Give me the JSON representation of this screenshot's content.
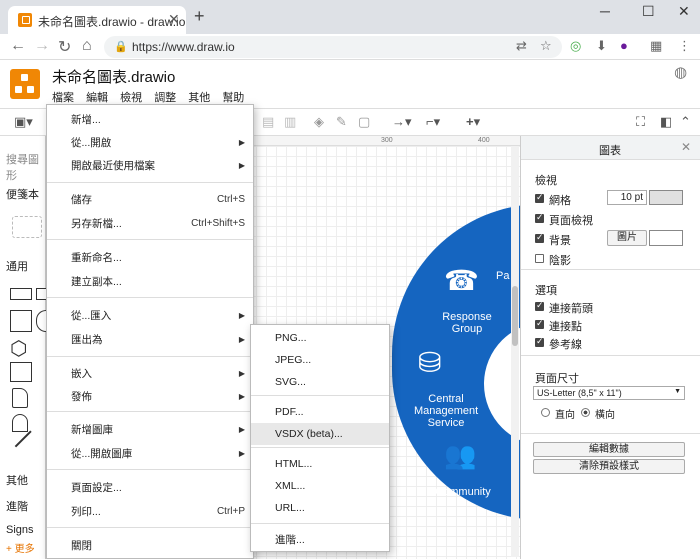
{
  "browser": {
    "tab_title": "未命名圖表.drawio - draw.io",
    "tab_close": "✕",
    "new_tab": "+",
    "win_min": "─",
    "win_max": "☐",
    "win_close": "✕",
    "url": "https://www.draw.io"
  },
  "app": {
    "doc_title": "未命名圖表.drawio",
    "menus": [
      "檔案",
      "編輯",
      "檢視",
      "調整",
      "其他",
      "幫助"
    ]
  },
  "left_panel": {
    "search_placeholder": "搜尋圖形",
    "scratchpad": "便箋本",
    "general": "通用",
    "other": "其他",
    "advanced": "進階",
    "signs": "Signs",
    "more": "+ 更多"
  },
  "canvas": {
    "ruler_marks": [
      "300",
      "400"
    ],
    "labels": {
      "response_group": "Response Group",
      "central_mgmt": "Central Management Service",
      "community": "Community",
      "pa": "Pa"
    }
  },
  "right_panel": {
    "title": "圖表",
    "view_title": "檢視",
    "grid": "網格",
    "grid_size": "10 pt",
    "page_view": "頁面檢視",
    "background": "背景",
    "image_btn": "圖片",
    "shadow": "陰影",
    "options_title": "選項",
    "conn_arrows": "連接箭頭",
    "conn_points": "連接點",
    "guides": "參考線",
    "page_size_title": "頁面尺寸",
    "page_size_value": "US-Letter (8,5\" x 11\")",
    "portrait": "直向",
    "landscape": "橫向",
    "edit_data_btn": "編輯數據",
    "clear_style_btn": "清除預設樣式"
  },
  "file_menu": [
    {
      "label": "新增...",
      "shortcut": "",
      "arrow": false
    },
    {
      "label": "從...開啟",
      "shortcut": "",
      "arrow": true
    },
    {
      "label": "開啟最近使用檔案",
      "shortcut": "",
      "arrow": true
    },
    {
      "label": "儲存",
      "shortcut": "Ctrl+S",
      "arrow": false
    },
    {
      "label": "另存新檔...",
      "shortcut": "Ctrl+Shift+S",
      "arrow": false
    },
    {
      "label": "重新命名...",
      "shortcut": "",
      "arrow": false
    },
    {
      "label": "建立副本...",
      "shortcut": "",
      "arrow": false
    },
    {
      "label": "從...匯入",
      "shortcut": "",
      "arrow": true
    },
    {
      "label": "匯出為",
      "shortcut": "",
      "arrow": true
    },
    {
      "label": "嵌入",
      "shortcut": "",
      "arrow": true
    },
    {
      "label": "發佈",
      "shortcut": "",
      "arrow": true
    },
    {
      "label": "新增圖庫",
      "shortcut": "",
      "arrow": true
    },
    {
      "label": "從...開啟圖庫",
      "shortcut": "",
      "arrow": true
    },
    {
      "label": "頁面設定...",
      "shortcut": "",
      "arrow": false
    },
    {
      "label": "列印...",
      "shortcut": "Ctrl+P",
      "arrow": false
    },
    {
      "label": "關閉",
      "shortcut": "",
      "arrow": false
    }
  ],
  "export_menu": [
    "PNG...",
    "JPEG...",
    "SVG...",
    "PDF...",
    "VSDX (beta)...",
    "HTML...",
    "XML...",
    "URL...",
    "進階..."
  ],
  "colors": {
    "accent": "#f08705",
    "diagram_blue": "#1565c0",
    "more_orange": "#e67300"
  }
}
